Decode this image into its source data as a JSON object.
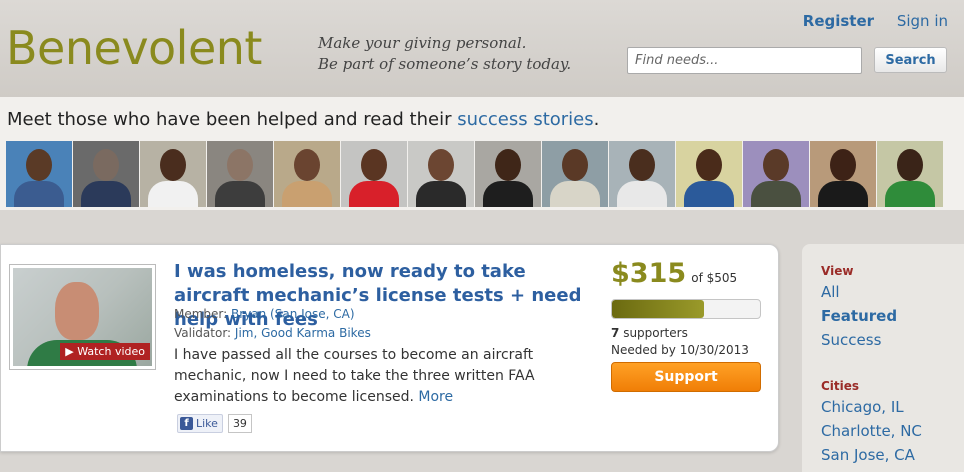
{
  "header": {
    "logo_text": "Benevolent",
    "tagline_line1": "Make your giving personal.",
    "tagline_line2": "Be part of someone’s story today.",
    "register": "Register",
    "sign_in": "Sign in",
    "search_placeholder": "Find needs...",
    "search_button": "Search"
  },
  "stories": {
    "heading_prefix": "Meet those who have been helped and read their ",
    "heading_link": "success stories",
    "heading_suffix": ".",
    "thumbnails": [
      {
        "bg": "#4a82b8",
        "skin": "#5a3a26",
        "shirt": "#3b5c90"
      },
      {
        "bg": "#6a6a6a",
        "skin": "#7a6a60",
        "shirt": "#2b3a5a"
      },
      {
        "bg": "#b7b2a4",
        "skin": "#4a2d1e",
        "shirt": "#f1f1f1"
      },
      {
        "bg": "#8a8680",
        "skin": "#8c7566",
        "shirt": "#3d3d3d"
      },
      {
        "bg": "#b9a98a",
        "skin": "#6a4430",
        "shirt": "#c9a070"
      },
      {
        "bg": "#c4c4c2",
        "skin": "#5a3522",
        "shirt": "#d8202a"
      },
      {
        "bg": "#c9c9c6",
        "skin": "#6c4632",
        "shirt": "#2a2a2a"
      },
      {
        "bg": "#a9a7a2",
        "skin": "#3f2618",
        "shirt": "#1e1e1e"
      },
      {
        "bg": "#8e9ea5",
        "skin": "#5a3926",
        "shirt": "#d8d5c8"
      },
      {
        "bg": "#a8b3b8",
        "skin": "#4a2e1e",
        "shirt": "#e8e8e8"
      },
      {
        "bg": "#d8d3a0",
        "skin": "#4a2b1a",
        "shirt": "#2b5a9a"
      },
      {
        "bg": "#9c8fbd",
        "skin": "#5a3a28",
        "shirt": "#4a5040"
      },
      {
        "bg": "#b89a7a",
        "skin": "#3d2216",
        "shirt": "#1a1a1a"
      },
      {
        "bg": "#c5c7a5",
        "skin": "#3a2418",
        "shirt": "#2f8c3a"
      }
    ]
  },
  "need": {
    "watch_video": "▶ Watch video",
    "title": "I was homeless, now ready to take aircraft mechanic’s license tests + need help with fees",
    "member_label": "Member: ",
    "member_value": "Bryan (San Jose, CA)",
    "validator_label": "Validator: ",
    "validator_value": "Jim, Good Karma Bikes",
    "description": "I have passed all the courses to become an aircraft mechanic, now I need to take the three written FAA examinations to become licensed.",
    "more": "More",
    "like_label": "Like",
    "like_count": "39",
    "raised": "$315",
    "goal": "of $505",
    "progress_fraction": 0.62,
    "supporters_count": "7",
    "supporters_label": "supporters",
    "needed_by": "Needed by 10/30/2013",
    "support_button": "Support"
  },
  "sidebar": {
    "view_heading": "View",
    "view_items": [
      "All",
      "Featured",
      "Success"
    ],
    "cities_heading": "Cities",
    "cities": [
      "Chicago, IL",
      "Charlotte, NC",
      "San Jose, CA"
    ]
  },
  "colors": {
    "brand_olive": "#8a8a1e",
    "link_blue": "#2d6aa3",
    "support_orange": "#f58a0c",
    "heading_red": "#9a2b27"
  }
}
